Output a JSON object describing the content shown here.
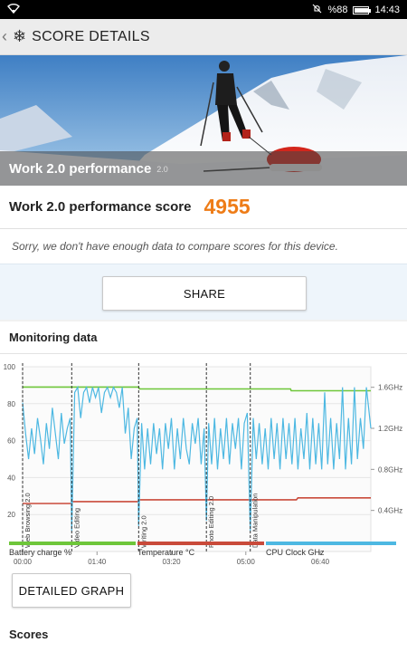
{
  "status_bar": {
    "icons": [
      "wifi-icon",
      "mute-icon",
      "battery-icon"
    ],
    "battery": "%88",
    "battery_level": 0.88,
    "time": "14:43"
  },
  "app_bar": {
    "title": "SCORE DETAILS",
    "logo_icon": "snowflake-logo-icon"
  },
  "hero": {
    "name": "Work 2.0 performance",
    "version": "2.0"
  },
  "score": {
    "label": "Work 2.0 performance score",
    "value": "4955",
    "color": "#ee7c17"
  },
  "notice": "Sorry, we don't have enough data to compare scores for this device.",
  "share_label": "SHARE",
  "monitoring": {
    "title": "Monitoring data",
    "detailed_graph_label": "DETAILED GRAPH",
    "legend": [
      {
        "label": "Battery charge %",
        "color": "#6ec63a"
      },
      {
        "label": "Temperature °C",
        "color": "#c94a3a"
      },
      {
        "label": "CPU Clock GHz",
        "color": "#4db8e2"
      }
    ]
  },
  "scores_title": "Scores",
  "chart_data": {
    "type": "line",
    "x_ticks": [
      "00:00",
      "01:40",
      "03:20",
      "05:00",
      "06:40"
    ],
    "x_range_seconds": [
      0,
      468
    ],
    "y_left_ticks": [
      "20",
      "40",
      "60",
      "80",
      "100"
    ],
    "y_left_range": [
      0,
      100
    ],
    "y_right_ticks": [
      "0.4GHz",
      "0.8GHz",
      "1.2GHz",
      "1.6GHz"
    ],
    "y_right_range_ghz": [
      0,
      1.8
    ],
    "markers": [
      {
        "label": "Web Browsing 2.0",
        "time_seconds": 0
      },
      {
        "label": "Video Editing",
        "time_seconds": 66
      },
      {
        "label": "Writing 2.0",
        "time_seconds": 156
      },
      {
        "label": "Photo Editing 2.0",
        "time_seconds": 247
      },
      {
        "label": "Data Manipulation",
        "time_seconds": 306
      }
    ],
    "series": [
      {
        "name": "Battery charge %",
        "axis": "left",
        "color": "#6ec63a",
        "points": [
          [
            0,
            89
          ],
          [
            156,
            89
          ],
          [
            157,
            88
          ],
          [
            360,
            88
          ],
          [
            361,
            87
          ],
          [
            468,
            87
          ]
        ]
      },
      {
        "name": "Temperature °C",
        "axis": "left",
        "color": "#c94a3a",
        "points": [
          [
            0,
            26
          ],
          [
            66,
            26
          ],
          [
            67,
            27
          ],
          [
            155,
            27
          ],
          [
            156,
            28
          ],
          [
            368,
            28
          ],
          [
            370,
            29
          ],
          [
            468,
            29
          ]
        ]
      },
      {
        "name": "CPU Clock GHz",
        "axis": "right",
        "color": "#4db8e2",
        "points": [
          [
            0,
            1.45
          ],
          [
            4,
            1.15
          ],
          [
            8,
            0.9
          ],
          [
            12,
            1.2
          ],
          [
            16,
            0.95
          ],
          [
            20,
            1.3
          ],
          [
            24,
            1.1
          ],
          [
            28,
            0.85
          ],
          [
            32,
            1.25
          ],
          [
            36,
            1.0
          ],
          [
            40,
            1.4
          ],
          [
            44,
            1.15
          ],
          [
            48,
            0.9
          ],
          [
            52,
            1.35
          ],
          [
            56,
            1.05
          ],
          [
            60,
            1.2
          ],
          [
            64,
            1.3
          ],
          [
            66,
            0.2
          ],
          [
            70,
            1.55
          ],
          [
            74,
            1.6
          ],
          [
            78,
            1.3
          ],
          [
            82,
            1.55
          ],
          [
            86,
            1.6
          ],
          [
            90,
            1.45
          ],
          [
            94,
            1.6
          ],
          [
            98,
            1.5
          ],
          [
            102,
            1.6
          ],
          [
            106,
            1.35
          ],
          [
            110,
            1.55
          ],
          [
            114,
            1.6
          ],
          [
            118,
            1.5
          ],
          [
            122,
            1.6
          ],
          [
            126,
            1.55
          ],
          [
            130,
            1.4
          ],
          [
            134,
            1.6
          ],
          [
            138,
            1.15
          ],
          [
            142,
            1.4
          ],
          [
            146,
            0.9
          ],
          [
            150,
            1.2
          ],
          [
            154,
            1.3
          ],
          [
            156,
            0.25
          ],
          [
            160,
            1.25
          ],
          [
            164,
            0.8
          ],
          [
            168,
            1.2
          ],
          [
            172,
            0.85
          ],
          [
            176,
            1.25
          ],
          [
            180,
            0.95
          ],
          [
            184,
            1.2
          ],
          [
            188,
            0.8
          ],
          [
            192,
            1.25
          ],
          [
            196,
            1.0
          ],
          [
            200,
            1.3
          ],
          [
            204,
            0.8
          ],
          [
            208,
            1.2
          ],
          [
            212,
            0.9
          ],
          [
            216,
            1.3
          ],
          [
            220,
            1.0
          ],
          [
            224,
            0.85
          ],
          [
            228,
            1.25
          ],
          [
            232,
            1.05
          ],
          [
            236,
            1.3
          ],
          [
            240,
            0.85
          ],
          [
            244,
            1.2
          ],
          [
            247,
            0.3
          ],
          [
            250,
            1.25
          ],
          [
            254,
            0.85
          ],
          [
            258,
            1.3
          ],
          [
            262,
            0.8
          ],
          [
            266,
            1.2
          ],
          [
            270,
            0.9
          ],
          [
            274,
            1.3
          ],
          [
            278,
            0.85
          ],
          [
            282,
            1.25
          ],
          [
            286,
            1.0
          ],
          [
            290,
            1.3
          ],
          [
            294,
            0.8
          ],
          [
            298,
            1.25
          ],
          [
            302,
            1.35
          ],
          [
            306,
            0.2
          ],
          [
            310,
            1.3
          ],
          [
            314,
            0.9
          ],
          [
            318,
            1.25
          ],
          [
            322,
            0.85
          ],
          [
            326,
            1.2
          ],
          [
            330,
            0.8
          ],
          [
            334,
            1.3
          ],
          [
            338,
            0.9
          ],
          [
            342,
            1.25
          ],
          [
            346,
            0.8
          ],
          [
            350,
            1.3
          ],
          [
            354,
            0.9
          ],
          [
            358,
            1.25
          ],
          [
            362,
            0.85
          ],
          [
            366,
            1.3
          ],
          [
            370,
            0.8
          ],
          [
            374,
            1.2
          ],
          [
            378,
            0.9
          ],
          [
            382,
            1.35
          ],
          [
            386,
            0.8
          ],
          [
            390,
            1.3
          ],
          [
            394,
            0.85
          ],
          [
            398,
            1.25
          ],
          [
            402,
            0.8
          ],
          [
            406,
            1.55
          ],
          [
            410,
            0.85
          ],
          [
            414,
            1.3
          ],
          [
            418,
            0.8
          ],
          [
            422,
            1.25
          ],
          [
            426,
            0.9
          ],
          [
            430,
            1.6
          ],
          [
            434,
            0.8
          ],
          [
            438,
            1.3
          ],
          [
            442,
            0.85
          ],
          [
            446,
            1.6
          ],
          [
            450,
            0.9
          ],
          [
            454,
            1.3
          ],
          [
            458,
            1.0
          ],
          [
            462,
            1.6
          ],
          [
            468,
            1.2
          ]
        ]
      }
    ],
    "grid": true
  }
}
